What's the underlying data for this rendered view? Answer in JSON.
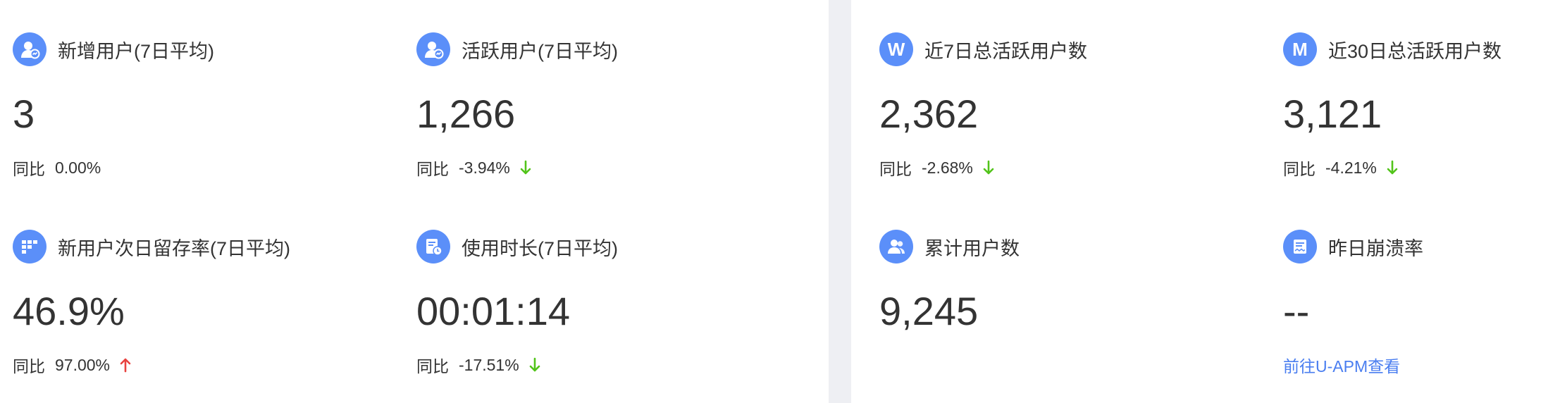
{
  "colors": {
    "accent": "#5b8ff9",
    "down": "#52c41a",
    "up": "#e84340",
    "link": "#4a7ef0",
    "divider": "#eeeff3"
  },
  "left_panel": {
    "cards": [
      {
        "icon": "user-chart-icon",
        "title": "新增用户(7日平均)",
        "value": "3",
        "compare_label": "同比",
        "compare_value": "0.00%",
        "trend": "none"
      },
      {
        "icon": "user-chart-icon",
        "title": "活跃用户(7日平均)",
        "value": "1,266",
        "compare_label": "同比",
        "compare_value": "-3.94%",
        "trend": "down"
      },
      {
        "icon": "grid-icon",
        "title": "新用户次日留存率(7日平均)",
        "value": "46.9%",
        "compare_label": "同比",
        "compare_value": "97.00%",
        "trend": "up"
      },
      {
        "icon": "document-clock-icon",
        "title": "使用时长(7日平均)",
        "value": "00:01:14",
        "compare_label": "同比",
        "compare_value": "-17.51%",
        "trend": "down"
      }
    ]
  },
  "right_panel": {
    "cards": [
      {
        "icon": "W",
        "title": "近7日总活跃用户数",
        "value": "2,362",
        "compare_label": "同比",
        "compare_value": "-2.68%",
        "trend": "down"
      },
      {
        "icon": "M",
        "title": "近30日总活跃用户数",
        "value": "3,121",
        "compare_label": "同比",
        "compare_value": "-4.21%",
        "trend": "down"
      },
      {
        "icon": "users-icon",
        "title": "累计用户数",
        "value": "9,245"
      },
      {
        "icon": "crash-report-icon",
        "title": "昨日崩溃率",
        "value": "--",
        "link": "前往U-APM查看"
      }
    ]
  }
}
